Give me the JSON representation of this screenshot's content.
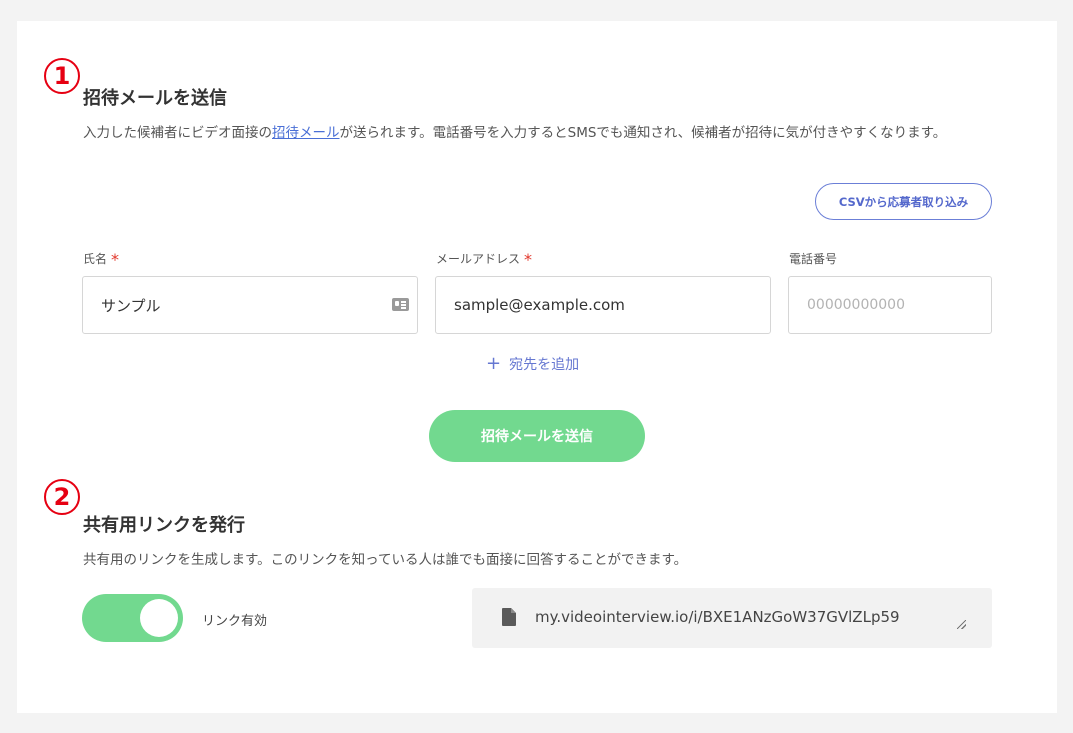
{
  "annotations": {
    "one": "1",
    "two": "2"
  },
  "invite": {
    "title": "招待メールを送信",
    "desc_before": "入力した候補者にビデオ面接の",
    "desc_link": "招待メール",
    "desc_after": "が送られます。電話番号を入力するとSMSでも通知され、候補者が招待に気が付きやすくなります。",
    "csv_button": "CSVから応募者取り込み",
    "fields": {
      "name": {
        "label": "氏名",
        "required_mark": "*",
        "value": "サンプル"
      },
      "email": {
        "label": "メールアドレス",
        "required_mark": "*",
        "value": "sample@example.com"
      },
      "phone": {
        "label": "電話番号",
        "placeholder": "00000000000"
      }
    },
    "add_recipient_icon": "+",
    "add_recipient": "宛先を追加",
    "send_button": "招待メールを送信"
  },
  "share": {
    "title": "共有用リンクを発行",
    "desc": "共有用のリンクを生成します。このリンクを知っている人は誰でも面接に回答することができます。",
    "toggle_label": "リンク有効",
    "toggle_on": true,
    "link": "my.videointerview.io/i/BXE1ANzGoW37GVlZLp59"
  },
  "colors": {
    "accent_green": "#72d98f",
    "link_blue": "#4a6fd6",
    "required_red": "#e2372b",
    "annotation_red": "#e60012"
  },
  "icons": {
    "name_field": "contact-card-icon",
    "link_box": "document-icon",
    "resize": "resize-handle-icon"
  }
}
